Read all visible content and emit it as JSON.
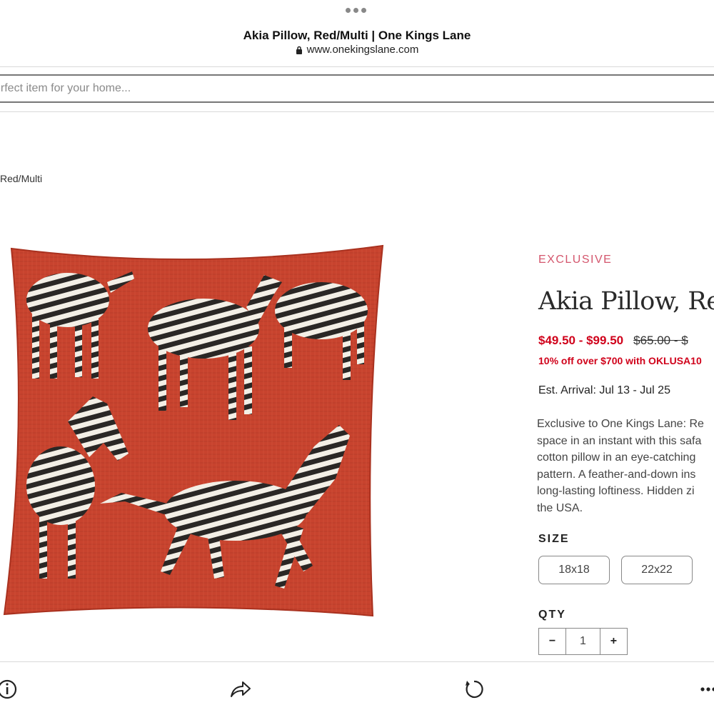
{
  "browser": {
    "title": "Akia Pillow, Red/Multi | One Kings Lane",
    "url": "www.onekingslane.com"
  },
  "search": {
    "placeholder": "erfect item for your home..."
  },
  "breadcrumb": {
    "text": "Red/Multi"
  },
  "product": {
    "badge": "EXCLUSIVE",
    "title": "Akia Pillow, Red/",
    "sale_price": "$49.50 - $99.50",
    "original_price": "$65.00 - $",
    "promo": "10% off over $700 with OKLUSA10",
    "arrival": "Est. Arrival: Jul 13 - Jul 25",
    "description_lines": [
      "Exclusive to One Kings Lane: Re",
      "space in an instant with this safa",
      "cotton pillow in an eye-catching",
      "pattern. A feather-and-down ins",
      "long-lasting loftiness. Hidden zi",
      "the USA."
    ],
    "image_icon": "zebra-pillow-image"
  },
  "size": {
    "label": "SIZE",
    "options": [
      "18x18",
      "22x22"
    ]
  },
  "qty": {
    "label": "QTY",
    "minus": "−",
    "value": "1",
    "plus": "+"
  },
  "toolbar": {
    "icons": [
      "info-icon",
      "share-icon",
      "reload-icon",
      "more-icon"
    ]
  },
  "colors": {
    "sale_red": "#d0021b",
    "exclusive_pink": "#d4566d",
    "pillow_red": "#c8432e"
  }
}
